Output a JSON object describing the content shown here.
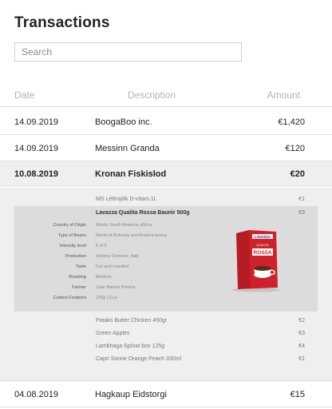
{
  "title": "Transactions",
  "search": {
    "placeholder": "Search"
  },
  "columns": {
    "date": "Date",
    "description": "Description",
    "amount": "Amount"
  },
  "transactions": [
    {
      "date": "14.09.2019",
      "description": "BoogaBoo inc.",
      "amount": "€1,420"
    },
    {
      "date": "14.09.2019",
      "description": "Messinn Granda",
      "amount": "€120"
    },
    {
      "date": "10.08.2019",
      "description": "Kronan Fiskislod",
      "amount": "€20"
    },
    {
      "date": "04.08.2019",
      "description": "Hagkaup Eidstorgi",
      "amount": "€15"
    }
  ],
  "items_before": [
    {
      "name": "MS Léttmjólk D-vítam.1L",
      "price": "€1"
    }
  ],
  "featured": {
    "name": "Lavazza Qualita Rossa Baunir 500g",
    "price": "€9",
    "attributes": [
      {
        "label": "Country of Origin",
        "value": "Mainly South America, Africa"
      },
      {
        "label": "Type of Beans",
        "value": "Blend of Robusta and Arabica beans"
      },
      {
        "label": "Intensity level",
        "value": "5 of 5"
      },
      {
        "label": "Production",
        "value": "Settimo Torinese, Italy"
      },
      {
        "label": "Taste",
        "value": "Full and rounded"
      },
      {
        "label": "Roasting",
        "value": "Medium"
      },
      {
        "label": "Farmer",
        "value": "Juan Batista Pereira"
      },
      {
        "label": "Carbon Footprint",
        "value": "235g CO₂e"
      }
    ],
    "package": {
      "brand": "LAVAZZA",
      "line1": "QUALITÀ",
      "line2": "ROSSA",
      "color": "#d0202a"
    }
  },
  "items_after": [
    {
      "name": "Pataks Butter Chicken 450gr",
      "price": "€2"
    },
    {
      "name": "Green Apples",
      "price": "€3"
    },
    {
      "name": "Lambhaga Spínat box 125g",
      "price": "€4"
    },
    {
      "name": "Capri Sonne Orange Peach 330ml",
      "price": "€1"
    }
  ]
}
